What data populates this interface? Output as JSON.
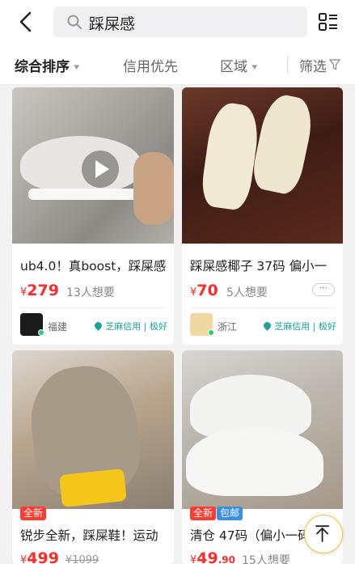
{
  "search": {
    "query": "踩屎感"
  },
  "filters": [
    {
      "label": "综合排序"
    },
    {
      "label": "信用优先"
    },
    {
      "label": "区域"
    },
    {
      "label": "筛选"
    }
  ],
  "items": [
    {
      "title": "ub4.0！真boost，踩屎感",
      "currency": "¥",
      "price": "279",
      "want": "13人想要",
      "location": "福建",
      "credit": "芝麻信用 | 极好"
    },
    {
      "title": "踩屎感椰子 37码 偏小一",
      "currency": "¥",
      "price": "70",
      "want": "5人想要",
      "location": "浙江",
      "credit": "芝麻信用 | 极好",
      "more": "···"
    },
    {
      "title": "锐步全新，踩屎鞋！运动",
      "currency": "¥",
      "price": "499",
      "old_price": "¥1099",
      "tags": [
        "全新"
      ]
    },
    {
      "title": "清仓 47码（偏小一码",
      "currency": "¥",
      "price": "49",
      "price_dec": ".90",
      "want": "15人想要",
      "tags": [
        "全新",
        "包邮"
      ]
    }
  ],
  "colors": {
    "price": "#ff2b2b",
    "credit": "#1aa39a",
    "tag_new": "#ff3b30",
    "tag_free": "#3a8ee6",
    "top_ring": "#f2c230"
  }
}
